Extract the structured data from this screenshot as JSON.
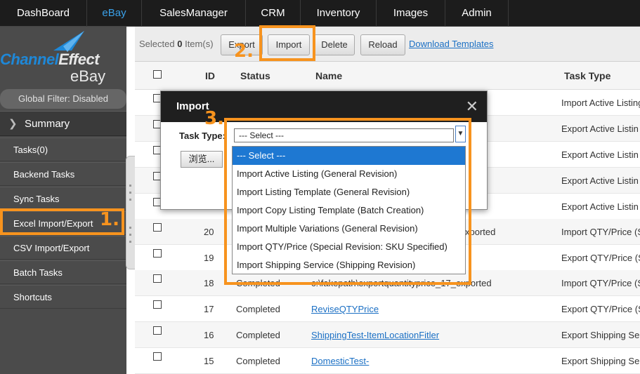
{
  "nav": {
    "items": [
      "DashBoard",
      "eBay",
      "SalesManager",
      "CRM",
      "Inventory",
      "Images",
      "Admin"
    ],
    "active": "eBay"
  },
  "sidebar": {
    "logo_line1_a": "Channel",
    "logo_line1_b": "Effect",
    "logo_line2": "eBay",
    "filter": "Global Filter: Disabled",
    "summary": "Summary",
    "items": [
      "Tasks(0)",
      "Backend Tasks",
      "Sync Tasks",
      "Excel Import/Export",
      "CSV Import/Export",
      "Batch Tasks",
      "Shortcuts"
    ]
  },
  "toolbar": {
    "selected_prefix": "Selected",
    "selected_count": "0",
    "selected_suffix": "Item(s)",
    "export": "Export",
    "import": "Import",
    "delete": "Delete",
    "reload": "Reload",
    "download": "Download Templates"
  },
  "table": {
    "headers": [
      "ID",
      "Status",
      "Name",
      "Task Type"
    ],
    "rows": [
      {
        "id": "",
        "status": "",
        "name": "",
        "type": "Import Active Listing"
      },
      {
        "id": "",
        "status": "",
        "name": "",
        "type": "Export Active Listin"
      },
      {
        "id": "",
        "status": "",
        "name": "",
        "type": "Export Active Listin"
      },
      {
        "id": "",
        "status": "",
        "name": "",
        "type": "Export Active Listin"
      },
      {
        "id": "",
        "status": "",
        "name": "",
        "type": "Export Active Listin"
      },
      {
        "id": "20",
        "status": "",
        "name": "xported",
        "type": "Import QTY/Price (S"
      },
      {
        "id": "19",
        "status": "",
        "name": "",
        "type": "Export QTY/Price (S"
      },
      {
        "id": "18",
        "status": "Completed",
        "name": "c:\\fakepath\\exportquantityprice_17_exported",
        "type": "Import QTY/Price (S"
      },
      {
        "id": "17",
        "status": "Completed",
        "name": "ReviseQTYPrice",
        "type": "Export QTY/Price (S"
      },
      {
        "id": "16",
        "status": "Completed",
        "name": "ShippingTest-ItemLocationFitler",
        "type": "Export Shipping Se"
      },
      {
        "id": "15",
        "status": "Completed",
        "name": "DomesticTest-",
        "type": "Export Shipping Se"
      }
    ]
  },
  "modal": {
    "title": "Import",
    "task_type_label": "Task Type:",
    "browse": "浏览...",
    "selected": "--- Select ---",
    "options": [
      "--- Select ---",
      "Import Active Listing (General Revision)",
      "Import Listing Template (General Revision)",
      "Import Copy Listing Template (Batch Creation)",
      "Import Multiple Variations (General Revision)",
      "Import QTY/Price (Special Revision: SKU Specified)",
      "Import Shipping Service (Shipping Revision)"
    ]
  },
  "annotations": {
    "step1": "1.",
    "step2": "2.",
    "step3": "3.",
    "color": "#f7931e"
  }
}
